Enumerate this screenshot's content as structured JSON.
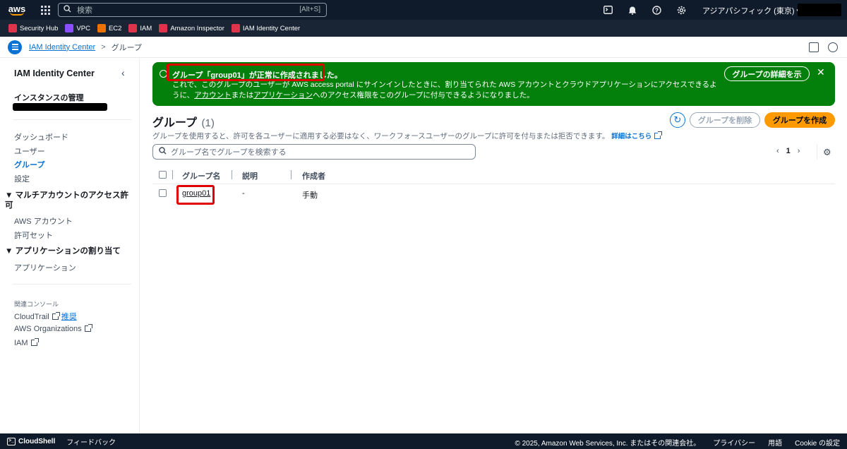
{
  "topnav": {
    "logo": "aws",
    "search_placeholder": "検索",
    "search_shortcut": "[Alt+S]",
    "region": "アジアパシフィック (東京) ▾",
    "icons": [
      "cloudshell-icon",
      "bell-icon",
      "help-icon",
      "gear-icon"
    ]
  },
  "favorites": [
    {
      "label": "Security Hub",
      "color": "#dd344c"
    },
    {
      "label": "VPC",
      "color": "#8c4fff"
    },
    {
      "label": "EC2",
      "color": "#ed7100"
    },
    {
      "label": "IAM",
      "color": "#dd344c"
    },
    {
      "label": "Amazon Inspector",
      "color": "#dd344c"
    },
    {
      "label": "IAM Identity Center",
      "color": "#dd344c"
    }
  ],
  "breadcrumb": {
    "root": "IAM Identity Center",
    "separator": ">",
    "current": "グループ"
  },
  "sidebar": {
    "title": "IAM Identity Center",
    "collapse": "‹",
    "instance_heading": "インスタンスの管理",
    "items": [
      "ダッシュボード",
      "ユーザー",
      "グループ",
      "設定"
    ],
    "active_item": "グループ",
    "section1": "▼ マルチアカウントのアクセス許可",
    "section1_items": [
      "AWS アカウント",
      "許可セット"
    ],
    "section2": "▼ アプリケーションの割り当て",
    "section2_items": [
      "アプリケーション"
    ],
    "related_heading": "関連コンソール",
    "related": [
      {
        "label": "CloudTrail",
        "tag": "推奨"
      },
      {
        "label": "AWS Organizations",
        "tag": ""
      },
      {
        "label": "IAM",
        "tag": ""
      }
    ]
  },
  "flash": {
    "title": "グループ「group01」が正常に作成されました。",
    "body_part1": "これで、このグループのユーザーが AWS access portal にサインインしたときに、割り当てられた AWS アカウントとクラウドアプリケーションにアクセスできるように、",
    "body_link1": "アカウント",
    "body_part2": "または",
    "body_link2": "アプリケーション",
    "body_part3": "へのアクセス権限をこのグループに付与できるようになりました。",
    "button": "グループの詳細を示",
    "close": "✕",
    "color": "#037f0c"
  },
  "main": {
    "title": "グループ",
    "count": "(1)",
    "description": "グループを使用すると、許可を各ユーザーに適用する必要はなく、ワークフォースユーザーのグループに許可を付与または拒否できます。",
    "info_link": "詳細はこちら",
    "delete_button": "グループを削除",
    "create_button": "グループを作成",
    "search_placeholder": "グループ名でグループを検索する",
    "page": "1",
    "prev": "‹",
    "next": "›"
  },
  "table": {
    "columns": [
      "グループ名",
      "説明",
      "作成者"
    ],
    "rows": [
      {
        "name": "group01",
        "description": "-",
        "created_by": "手動"
      }
    ]
  },
  "footer": {
    "cloudshell": "CloudShell",
    "feedback": "フィードバック",
    "copyright": "© 2025, Amazon Web Services, Inc. またはその関連会社。",
    "privacy": "プライバシー",
    "terms": "用語",
    "cookie": "Cookie の設定"
  }
}
